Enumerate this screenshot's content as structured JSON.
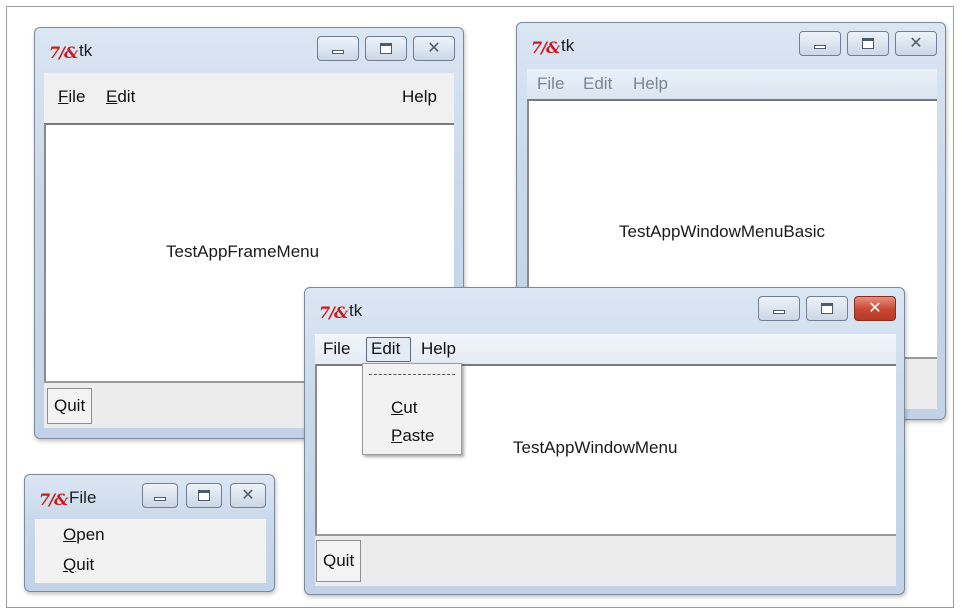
{
  "windows": {
    "frame_menu": {
      "title": "tk",
      "logo": "tk-feather-logo",
      "menu": {
        "file": "File",
        "edit": "Edit",
        "help": "Help"
      },
      "body_text": "TestAppFrameMenu",
      "quit_label": "Quit"
    },
    "window_menu_basic": {
      "title": "tk",
      "menu": {
        "file": "File",
        "edit": "Edit",
        "help": "Help"
      },
      "body_text": "TestAppWindowMenuBasic"
    },
    "window_menu": {
      "title": "tk",
      "menu": {
        "file": "File",
        "edit": "Edit",
        "help": "Help"
      },
      "body_text": "TestAppWindowMenu",
      "quit_label": "Quit",
      "edit_dropdown": {
        "cut": "Cut",
        "paste": "Paste"
      }
    },
    "file_tearoff": {
      "title": "File",
      "items": {
        "open": "Open",
        "quit": "Quit"
      }
    }
  },
  "icons": {
    "minimize": "minimize-icon",
    "maximize": "maximize-icon",
    "close": "close-icon"
  },
  "colors": {
    "close_active": "#c74631",
    "logo_red": "#cc1a1a",
    "titlebar": "#c9d8ea"
  }
}
